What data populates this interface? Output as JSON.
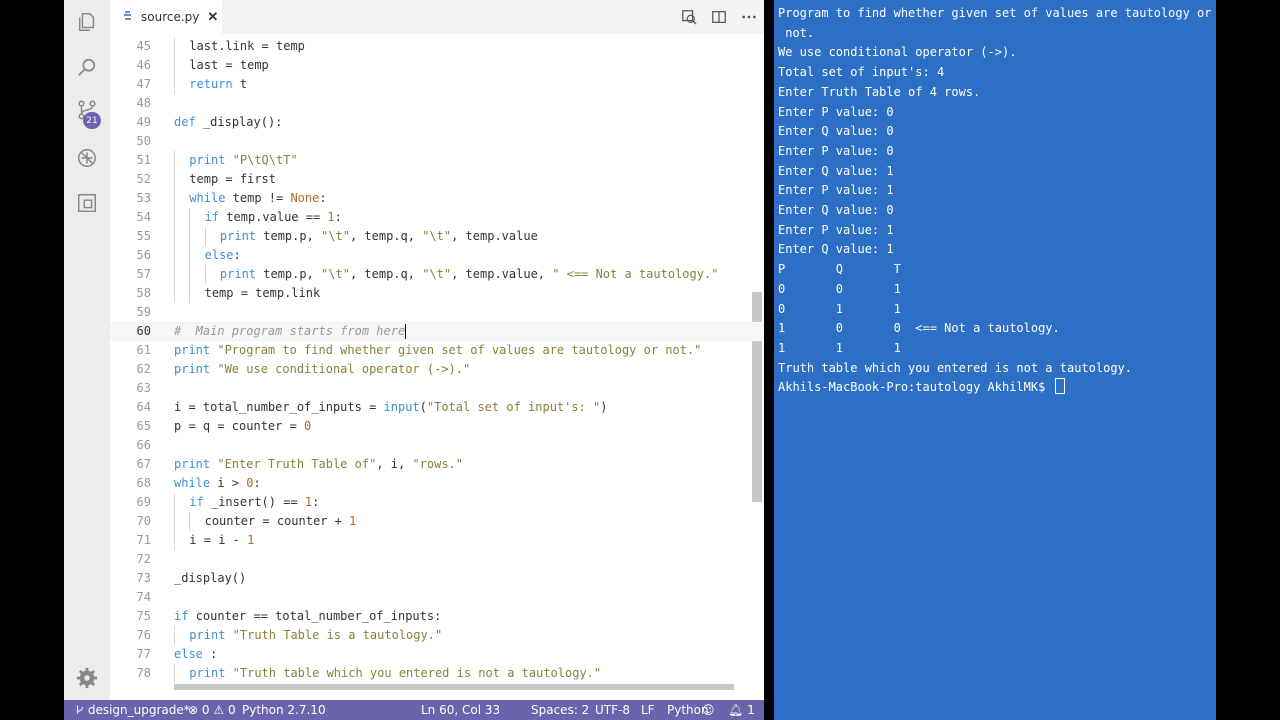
{
  "editor": {
    "tab_title": "source.py",
    "tab_close": "✕",
    "lines": [
      {
        "n": "45",
        "indent": 1,
        "tokens": [
          [
            "",
            "last.link = temp"
          ]
        ]
      },
      {
        "n": "46",
        "indent": 1,
        "tokens": [
          [
            "",
            "last = temp"
          ]
        ]
      },
      {
        "n": "47",
        "indent": 1,
        "tokens": [
          [
            "kw",
            "return"
          ],
          [
            "",
            " t"
          ]
        ]
      },
      {
        "n": "48",
        "indent": 0,
        "tokens": []
      },
      {
        "n": "49",
        "indent": 0,
        "tokens": [
          [
            "kw",
            "def"
          ],
          [
            "",
            " "
          ],
          [
            "fn",
            "_display"
          ],
          [
            "",
            "():"
          ]
        ]
      },
      {
        "n": "50",
        "indent": 0,
        "tokens": []
      },
      {
        "n": "51",
        "indent": 1,
        "tokens": [
          [
            "kw",
            "print"
          ],
          [
            "",
            " "
          ],
          [
            "str",
            "\"P\\tQ\\tT\""
          ]
        ]
      },
      {
        "n": "52",
        "indent": 1,
        "tokens": [
          [
            "",
            "temp = first"
          ]
        ]
      },
      {
        "n": "53",
        "indent": 1,
        "tokens": [
          [
            "kw",
            "while"
          ],
          [
            "",
            " temp != "
          ],
          [
            "bi",
            "None"
          ],
          [
            "",
            ":"
          ]
        ]
      },
      {
        "n": "54",
        "indent": 2,
        "tokens": [
          [
            "kw",
            "if"
          ],
          [
            "",
            " temp.value == "
          ],
          [
            "num",
            "1"
          ],
          [
            "",
            ":"
          ]
        ]
      },
      {
        "n": "55",
        "indent": 3,
        "tokens": [
          [
            "kw",
            "print"
          ],
          [
            "",
            " temp.p, "
          ],
          [
            "str",
            "\"\\t\""
          ],
          [
            "",
            ", temp.q, "
          ],
          [
            "str",
            "\"\\t\""
          ],
          [
            "",
            ", temp.value"
          ]
        ]
      },
      {
        "n": "56",
        "indent": 2,
        "tokens": [
          [
            "kw",
            "else"
          ],
          [
            "",
            ":"
          ]
        ]
      },
      {
        "n": "57",
        "indent": 3,
        "tokens": [
          [
            "kw",
            "print"
          ],
          [
            "",
            " temp.p, "
          ],
          [
            "str",
            "\"\\t\""
          ],
          [
            "",
            ", temp.q, "
          ],
          [
            "str",
            "\"\\t\""
          ],
          [
            "",
            ", temp.value, "
          ],
          [
            "str",
            "\" <== Not a tautology.\""
          ]
        ]
      },
      {
        "n": "58",
        "indent": 2,
        "tokens": [
          [
            "",
            "temp = temp.link"
          ]
        ]
      },
      {
        "n": "59",
        "indent": 0,
        "tokens": []
      },
      {
        "n": "60",
        "indent": 0,
        "tokens": [
          [
            "cmt",
            "#  Main program starts from here"
          ]
        ],
        "current": true
      },
      {
        "n": "61",
        "indent": 0,
        "tokens": [
          [
            "kw",
            "print"
          ],
          [
            "",
            " "
          ],
          [
            "str",
            "\"Program to find whether given set of values are tautology or not.\""
          ]
        ]
      },
      {
        "n": "62",
        "indent": 0,
        "tokens": [
          [
            "kw",
            "print"
          ],
          [
            "",
            " "
          ],
          [
            "str",
            "\"We use conditional operator (->).\""
          ]
        ]
      },
      {
        "n": "63",
        "indent": 0,
        "tokens": []
      },
      {
        "n": "64",
        "indent": 0,
        "tokens": [
          [
            "",
            "i = total_number_of_inputs = "
          ],
          [
            "kw",
            "input"
          ],
          [
            "",
            "("
          ],
          [
            "str",
            "\"Total set of input's: \""
          ],
          [
            "",
            ")"
          ]
        ]
      },
      {
        "n": "65",
        "indent": 0,
        "tokens": [
          [
            "",
            "p = q = counter = "
          ],
          [
            "num",
            "0"
          ]
        ]
      },
      {
        "n": "66",
        "indent": 0,
        "tokens": []
      },
      {
        "n": "67",
        "indent": 0,
        "tokens": [
          [
            "kw",
            "print"
          ],
          [
            "",
            " "
          ],
          [
            "str",
            "\"Enter Truth Table of\""
          ],
          [
            "",
            ", i, "
          ],
          [
            "str",
            "\"rows.\""
          ]
        ]
      },
      {
        "n": "68",
        "indent": 0,
        "tokens": [
          [
            "kw",
            "while"
          ],
          [
            "",
            " i > "
          ],
          [
            "num",
            "0"
          ],
          [
            "",
            ":"
          ]
        ]
      },
      {
        "n": "69",
        "indent": 1,
        "tokens": [
          [
            "kw",
            "if"
          ],
          [
            "",
            " _insert() == "
          ],
          [
            "num",
            "1"
          ],
          [
            "",
            ":"
          ]
        ]
      },
      {
        "n": "70",
        "indent": 2,
        "tokens": [
          [
            "",
            "counter = counter + "
          ],
          [
            "num",
            "1"
          ]
        ]
      },
      {
        "n": "71",
        "indent": 1,
        "tokens": [
          [
            "",
            "i = i - "
          ],
          [
            "num",
            "1"
          ]
        ]
      },
      {
        "n": "72",
        "indent": 0,
        "tokens": []
      },
      {
        "n": "73",
        "indent": 0,
        "tokens": [
          [
            "",
            "_display()"
          ]
        ]
      },
      {
        "n": "74",
        "indent": 0,
        "tokens": []
      },
      {
        "n": "75",
        "indent": 0,
        "tokens": [
          [
            "kw",
            "if"
          ],
          [
            "",
            " counter == total_number_of_inputs:"
          ]
        ]
      },
      {
        "n": "76",
        "indent": 1,
        "tokens": [
          [
            "kw",
            "print"
          ],
          [
            "",
            " "
          ],
          [
            "str",
            "\"Truth Table is a tautology.\""
          ]
        ]
      },
      {
        "n": "77",
        "indent": 0,
        "tokens": [
          [
            "kw",
            "else"
          ],
          [
            "",
            " :"
          ]
        ]
      },
      {
        "n": "78",
        "indent": 1,
        "tokens": [
          [
            "kw",
            "print"
          ],
          [
            "",
            " "
          ],
          [
            "str",
            "\"Truth table which you entered is not a tautology.\""
          ]
        ]
      }
    ]
  },
  "status_bar": {
    "branch": "design_upgrade*",
    "errors": "0",
    "warnings": "0",
    "interpreter": "Python 2.7.10",
    "position": "Ln 60, Col 33",
    "spaces": "Spaces: 2",
    "encoding": "UTF-8",
    "eol": "LF",
    "language": "Python",
    "notifications": "1"
  },
  "activity_bar": {
    "scm_badge": "21",
    "icons": [
      "files-icon",
      "search-icon",
      "source-control-icon",
      "debug-icon",
      "extensions-icon",
      "gear-icon"
    ]
  },
  "terminal": {
    "lines": [
      "Program to find whether given set of values are tautology or",
      " not.",
      "We use conditional operator (->).",
      "Total set of input's: 4",
      "Enter Truth Table of 4 rows.",
      "Enter P value: 0",
      "Enter Q value: 0",
      "Enter P value: 0",
      "Enter Q value: 1",
      "Enter P value: 1",
      "Enter Q value: 0",
      "Enter P value: 1",
      "Enter Q value: 1",
      "P       Q       T",
      "0       0       1",
      "0       1       1",
      "1       0       0  <== Not a tautology.",
      "1       1       1",
      "Truth table which you entered is not a tautology.",
      "Akhils-MacBook-Pro:tautology AkhilMK$ "
    ]
  },
  "colors": {
    "status_bar": "#6c63ad",
    "terminal_bg": "#2c6fc4"
  }
}
